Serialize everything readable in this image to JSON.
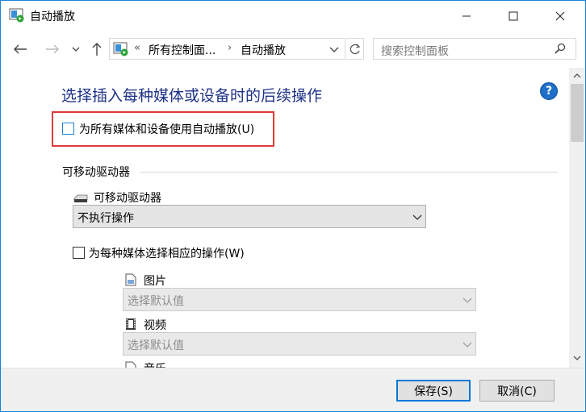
{
  "window": {
    "title": "自动播放",
    "controls": {
      "minimize": "minimize",
      "maximize": "maximize",
      "close": "close"
    }
  },
  "nav": {
    "address": {
      "overflow": "«",
      "crumb1": "所有控制面...",
      "separator": "›",
      "crumb2": "自动播放"
    },
    "search_placeholder": "搜索控制面板"
  },
  "content": {
    "title": "选择插入每种媒体或设备时的后续操作",
    "help": "?",
    "use_autoplay_label": "为所有媒体和设备使用自动播放(U)",
    "section_removable": "可移动驱动器",
    "drive_label": "可移动驱动器",
    "drive_action": "不执行操作",
    "per_media_label": "为每种媒体选择相应的操作(W)",
    "media": [
      {
        "label": "图片",
        "value": "选择默认值",
        "icon": "picture-icon"
      },
      {
        "label": "视频",
        "value": "选择默认值",
        "icon": "video-icon"
      },
      {
        "label": "音乐",
        "icon": "music-icon"
      }
    ]
  },
  "footer": {
    "save": "保存(S)",
    "cancel": "取消(C)"
  },
  "colors": {
    "accent": "#0078d7",
    "title": "#1e3287",
    "highlight": "#e03a3a",
    "help": "#1f6fc8"
  }
}
